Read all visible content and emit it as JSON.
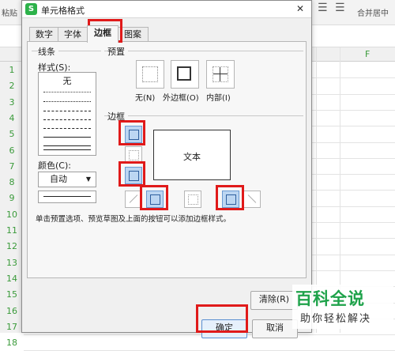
{
  "background": {
    "toolbar_left_text": "粘贴",
    "toolbar_right_text": "合并居中",
    "column_letter": "F",
    "rows": [
      "1",
      "2",
      "3",
      "4",
      "5",
      "6",
      "7",
      "8",
      "9",
      "10",
      "11",
      "12",
      "13",
      "14",
      "15",
      "16",
      "17",
      "18"
    ]
  },
  "dialog": {
    "app_icon_letter": "S",
    "title": "单元格格式",
    "close_glyph": "✕",
    "tabs": [
      "数字",
      "字体",
      "边框",
      "图案"
    ],
    "active_tab": "边框",
    "line_group": {
      "label": "线条",
      "style_label": "样式(S):",
      "none_style": "无",
      "color_label": "颜色(C):",
      "color_value": "自动"
    },
    "preset_group": {
      "label": "预置",
      "buttons": [
        {
          "label": "无(N)",
          "icon": "no-border-icon"
        },
        {
          "label": "外边框(O)",
          "icon": "outline-border-icon"
        },
        {
          "label": "内部(I)",
          "icon": "inside-border-icon"
        }
      ]
    },
    "border_group": {
      "label": "边框",
      "preview_text": "文本"
    },
    "hint": "单击预置选项、预览草图及上面的按钮可以添加边框样式。",
    "buttons": {
      "clear": "清除(R)",
      "ok": "确定",
      "cancel": "取消"
    }
  },
  "watermark": {
    "main": "百科全说",
    "sub": "助你轻松解决"
  },
  "colors": {
    "highlight": "#e01a1a",
    "selected_border_button": "#bcd6f2",
    "watermark_green": "#1ea24a"
  }
}
